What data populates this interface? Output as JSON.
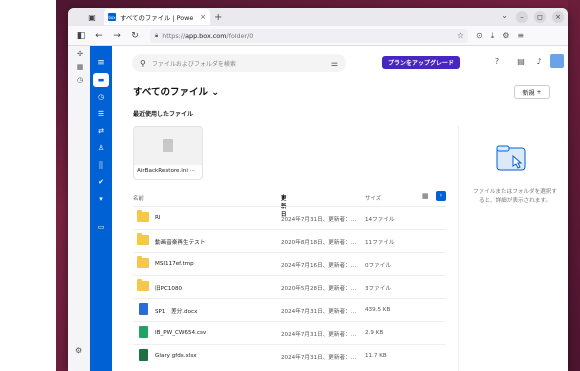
{
  "browser": {
    "tab_title": "すべてのファイル | Powe",
    "tab_close": "×",
    "new_tab": "+",
    "url_prefix": "https://",
    "url_host": "app.box.com",
    "url_path": "/folder/0",
    "window_buttons": [
      "–",
      "◻",
      "×"
    ]
  },
  "sidebar_left": {
    "icons": [
      "puzzle-icon",
      "bookmark-icon",
      "history-icon"
    ],
    "settings": "settings-gear-icon"
  },
  "box_nav": {
    "items": [
      "menu-icon",
      "folder-icon",
      "recents-icon",
      "tasks-icon",
      "workflow-icon",
      "users-icon",
      "apps-icon",
      "check-icon",
      "trash-icon",
      "notes-icon"
    ]
  },
  "header": {
    "search_placeholder": "ファイルおよびフォルダを検索",
    "upgrade_label": "プランをアップグレード"
  },
  "page": {
    "title": "すべてのファイル",
    "new_label": "新規",
    "recent_heading": "最近使用したファイル",
    "recent_file": "AirBackRestore.ini",
    "recent_more": "···"
  },
  "table": {
    "headers": {
      "name": "名前",
      "updated": "更新日",
      "size": "サイズ"
    },
    "rows": [
      {
        "type": "folder",
        "name": "RI",
        "date": "2024年7月31日、更新者：…",
        "size": "14ファイル"
      },
      {
        "type": "folder",
        "name": "動画音楽再生テスト",
        "date": "2020年8月18日、更新者：…",
        "size": "11ファイル"
      },
      {
        "type": "folder",
        "name": "MSI117ef.tmp",
        "date": "2024年7月16日、更新者：…",
        "size": "0ファイル"
      },
      {
        "type": "folder",
        "name": "旧PC1080",
        "date": "2020年5月28日、更新者：…",
        "size": "3ファイル"
      },
      {
        "type": "docx",
        "name": "SP1　差分.docx",
        "date": "2024年7月31日、更新者：…",
        "size": "439.5 KB"
      },
      {
        "type": "csv",
        "name": "IB_PW_CW654.csv",
        "date": "2024年7月31日、更新者：…",
        "size": "2.9 KB"
      },
      {
        "type": "xlsx",
        "name": "Glary gfds.xlsx",
        "date": "2024年7月31日、更新者：…",
        "size": "11.7 KB"
      }
    ]
  },
  "details_panel": {
    "message": "ファイルまたはフォルダを選択すると、詳細が表示されます。"
  },
  "colors": {
    "box_blue": "#0061d5",
    "upgrade_purple": "#4826c2",
    "folder_yellow": "#f5c84a"
  }
}
